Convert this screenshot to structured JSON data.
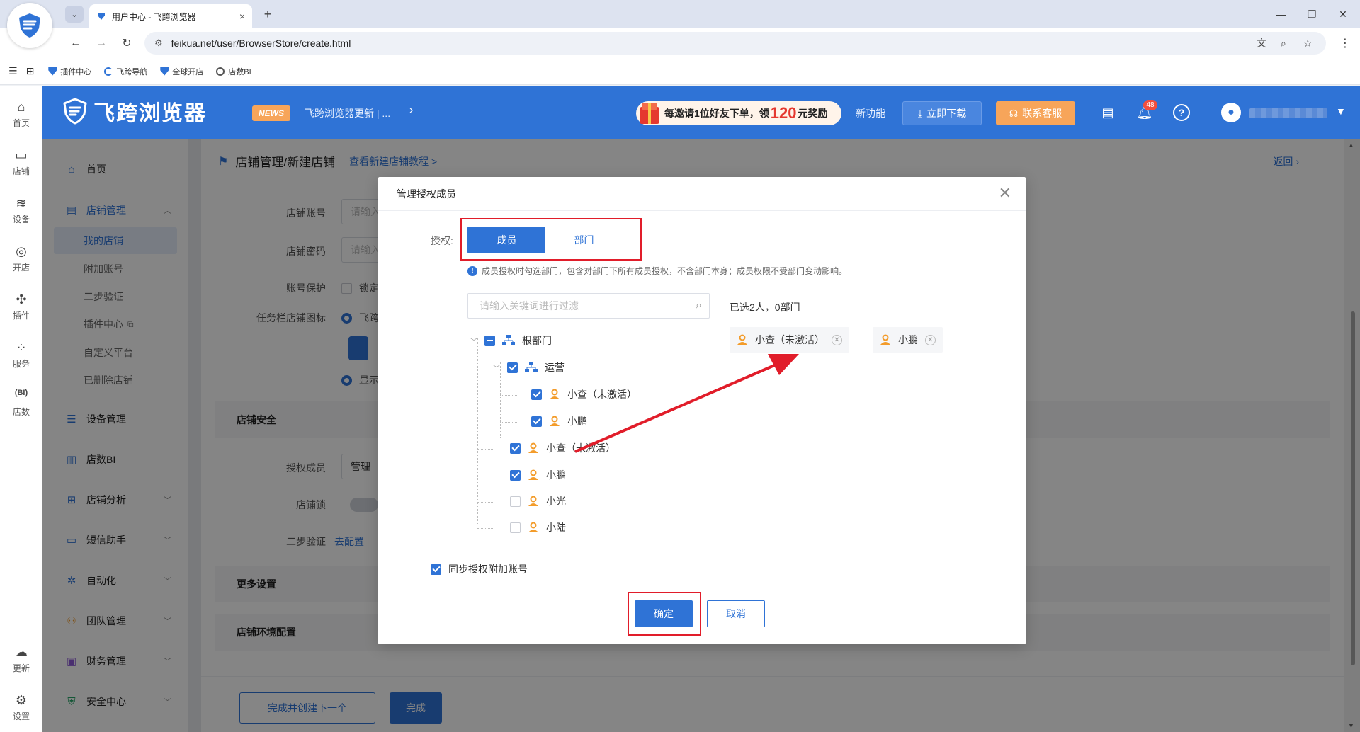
{
  "browser": {
    "tab_title": "用户中心 - 飞跨浏览器",
    "tab_close": "×",
    "new_tab": "+",
    "url": "feikua.net/user/BrowserStore/create.html",
    "bookmarks": [
      {
        "label": "插件中心",
        "icon": "feikua-icon",
        "color": "#2f73d6"
      },
      {
        "label": "飞跨导航",
        "icon": "c-logo-icon",
        "color": "#2f73d6"
      },
      {
        "label": "全球开店",
        "icon": "feikua-icon",
        "color": "#2f73d6"
      },
      {
        "label": "店数BI",
        "icon": "globe-icon",
        "color": "#555555"
      }
    ]
  },
  "header": {
    "logo_text": "飞跨浏览器",
    "news_badge": "NEWS",
    "news_text": "飞跨浏览器更新 | ...",
    "promo_prefix": "每邀请1位好友下单，领",
    "promo_amount": "120",
    "promo_suffix": "元奖励",
    "new_feature": "新功能",
    "download": "立即下载",
    "support": "联系客服",
    "notification_count": "48"
  },
  "rail": [
    {
      "label": "首页",
      "icon": "home-icon"
    },
    {
      "label": "店铺",
      "icon": "store-icon"
    },
    {
      "label": "设备",
      "icon": "layers-icon"
    },
    {
      "label": "开店",
      "icon": "planet-icon"
    },
    {
      "label": "插件",
      "icon": "puzzle-icon"
    },
    {
      "label": "服务",
      "icon": "grid-icon"
    },
    {
      "label": "店数",
      "icon": "bi-icon"
    },
    {
      "label": "更新",
      "icon": "cloud-upload-icon"
    },
    {
      "label": "设置",
      "icon": "settings-icon"
    }
  ],
  "menu": {
    "home": "首页",
    "store_mgmt": "店铺管理",
    "sub": [
      "我的店铺",
      "附加账号",
      "二步验证",
      "插件中心",
      "自定义平台",
      "已删除店铺"
    ],
    "device_mgmt": "设备管理",
    "store_bi": "店数BI",
    "store_analysis": "店铺分析",
    "sms": "短信助手",
    "automation": "自动化",
    "team": "团队管理",
    "finance": "财务管理",
    "security": "安全中心"
  },
  "main": {
    "crumb": "店铺管理/新建店铺",
    "tutorial_link": "查看新建店铺教程 >",
    "back": "返回",
    "labels": {
      "account": "店铺账号",
      "password": "店铺密码",
      "protect": "账号保护",
      "taskbar_icon": "任务栏店铺图标",
      "auth_members": "授权成员",
      "store_lock": "店铺锁",
      "two_step": "二步验证"
    },
    "input_placeholder": "请输入",
    "protect_text": "锁定",
    "radio1_text": "飞跨",
    "radio2_text": "显示",
    "manage_btn": "管理",
    "go_config": "去配置",
    "sections": {
      "security": "店铺安全",
      "more": "更多设置",
      "env": "店铺环境配置"
    },
    "btn_create_next": "完成并创建下一个",
    "btn_done": "完成"
  },
  "dialog": {
    "title": "管理授权成员",
    "auth_label": "授权:",
    "tab_members": "成员",
    "tab_department": "部门",
    "hint": "成员授权时勾选部门，包含对部门下所有成员授权，不含部门本身；成员权限不受部门变动影响。",
    "filter_placeholder": "请输入关键词进行过滤",
    "tree": {
      "root": "根部门",
      "ops": "运营",
      "ops_members": [
        "小查（未激活）",
        "小鹏"
      ],
      "root_members": [
        {
          "name": "小查（未激活）",
          "checked": true
        },
        {
          "name": "小鹏",
          "checked": true
        },
        {
          "name": "小光",
          "checked": false
        },
        {
          "name": "小陆",
          "checked": false
        }
      ]
    },
    "selected_summary": "已选2人，0部门",
    "chips": [
      "小查（未激活）",
      "小鹏"
    ],
    "sync_label": "同步授权附加账号",
    "ok": "确定",
    "cancel": "取消"
  },
  "colors": {
    "primary": "#2f73d6",
    "highlight": "#e11d2a",
    "user_icon": "#f39c2b"
  }
}
